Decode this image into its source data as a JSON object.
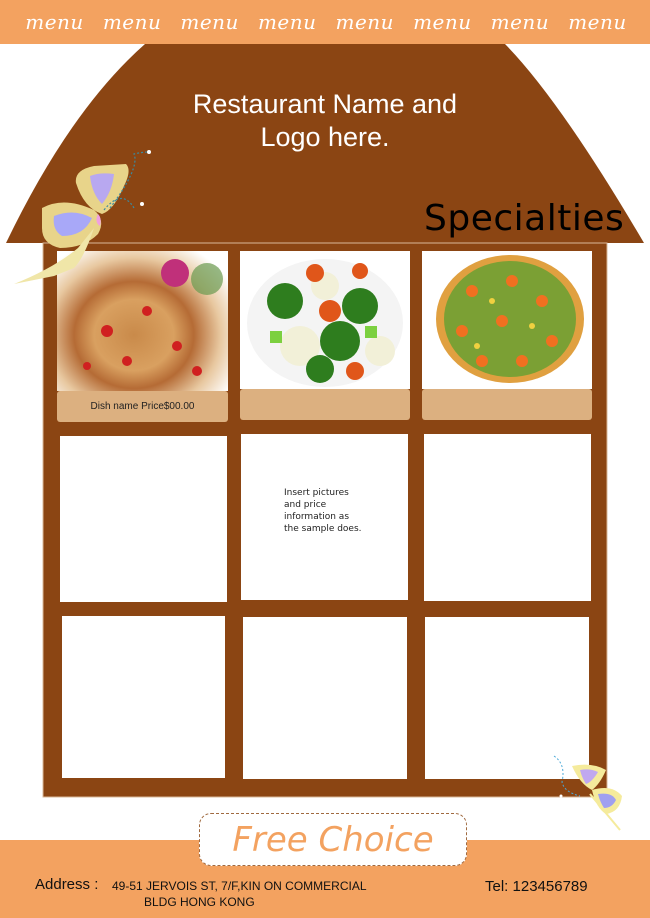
{
  "top_menu": [
    "menu",
    "menu",
    "menu",
    "menu",
    "menu",
    "menu",
    "menu",
    "menu"
  ],
  "header": {
    "title_line1": "Restaurant Name and",
    "title_line2": "Logo here.",
    "section_title": "Specialties"
  },
  "colors": {
    "brand_orange": "#f3a260",
    "house_brown": "#8b4513",
    "caption_tan": "#dcb080"
  },
  "dishes": [
    {
      "image": "stir-fried-chicken-photo",
      "caption": "Dish name  Price$00.00"
    },
    {
      "image": "broccoli-carrot-cauliflower-photo",
      "caption": ""
    },
    {
      "image": "mixed-vegetables-photo",
      "caption": ""
    }
  ],
  "placeholder_hint": [
    "Insert pictures",
    "and price",
    "information as",
    "the sample does."
  ],
  "footer": {
    "badge": "Free Choice",
    "address_label": "Address :",
    "address_line1": "49-51 JERVOIS ST, 7/F,KIN ON COMMERCIAL",
    "address_line2": "BLDG  HONG KONG",
    "tel": "Tel: 123456789"
  }
}
